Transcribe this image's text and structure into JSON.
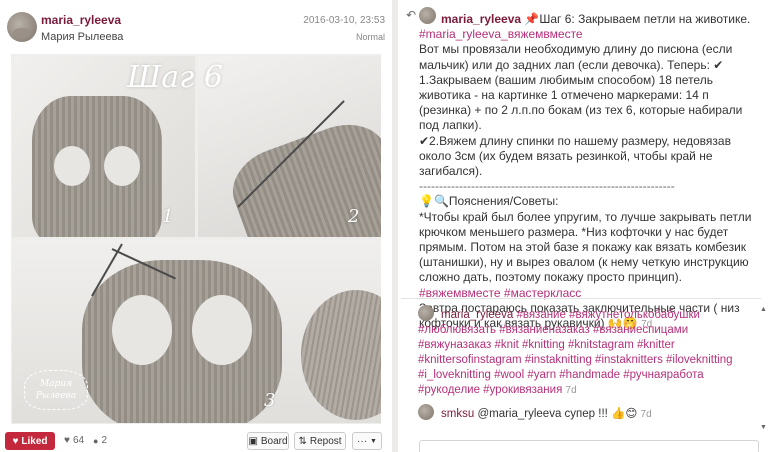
{
  "post": {
    "username": "maria_ryleeva",
    "full_name": "Мария Рылеева",
    "date": "2016-03-10, 23:53",
    "filter": "Normal",
    "image": {
      "title": "Шаг 6",
      "panel_numbers": [
        "1",
        "2",
        "3"
      ],
      "watermark": "Мария Рылеева"
    }
  },
  "actions": {
    "like_label": "Liked",
    "likes_count": "64",
    "comments_count": "2",
    "board_label": "Board",
    "repost_label": "Repost",
    "more_label": "···"
  },
  "caption": {
    "username": "maria_ryleeva",
    "lines": [
      "📌Шаг 6: Закрываем петли на животике."
    ],
    "hashtag1": "#maria_ryleeva_вяжемвместе",
    "body1": "Вот мы провязали необходимую длину до писюна (если мальчик) или до задних лап (если девочка). Теперь: ✔",
    "body2": "1.Закрываем (вашим любимым способом) 18 петель животика - на картинке 1 отмечено маркерами: 14 п (резинка) + по 2 л.п.по бокам (из тех 6, которые набирали под лапки).",
    "body3": "✔2.Вяжем длину спинки по нашему размеру, недовязав около 3см (их будем вязать резинкой, чтобы край не загибался).",
    "dashes": "----------------------------------------------------------------",
    "tips_title": "💡🔍Пояснения/Советы:",
    "tips_body": "*Чтобы край был более упругим, то лучше закрывать петли крючком меньшего размера. *Низ кофточки у нас будет прямым. Потом на этой базе я покажу как вязать комбезик (штанишки), ну и вырез овалом (к нему четкую инструкцию сложно дать, поэтому покажу просто принцип).",
    "hashtag2": "#вяжемвместе #мастеркласс",
    "closing": "Завтра постараюсь показать заключительные части ( низ кофточки и как вязать рукавички) 🙌🤭",
    "time": "7d"
  },
  "comments": [
    {
      "username": "maria_ryleeva",
      "text": "#вязание #вяжутнетолькобабушки #люблювязать #вязаниеназаказ #вязаниеспицами #вяжуназаказ #knit #knitting #knitstagram #knitter #knittersofinstagram #instaknitting #instaknitters #iloveknitting #i_loveknitting #wool #yarn #handmade #ручнаяработа #рукоделие #урокивязания",
      "time": "7d"
    },
    {
      "username": "smksu",
      "text": "@maria_ryleeva супер !!! 👍😊",
      "time": "7d"
    }
  ],
  "colors": {
    "accent": "#7a1b3a",
    "hashtag": "#b5307a",
    "like": "#c4283c"
  }
}
